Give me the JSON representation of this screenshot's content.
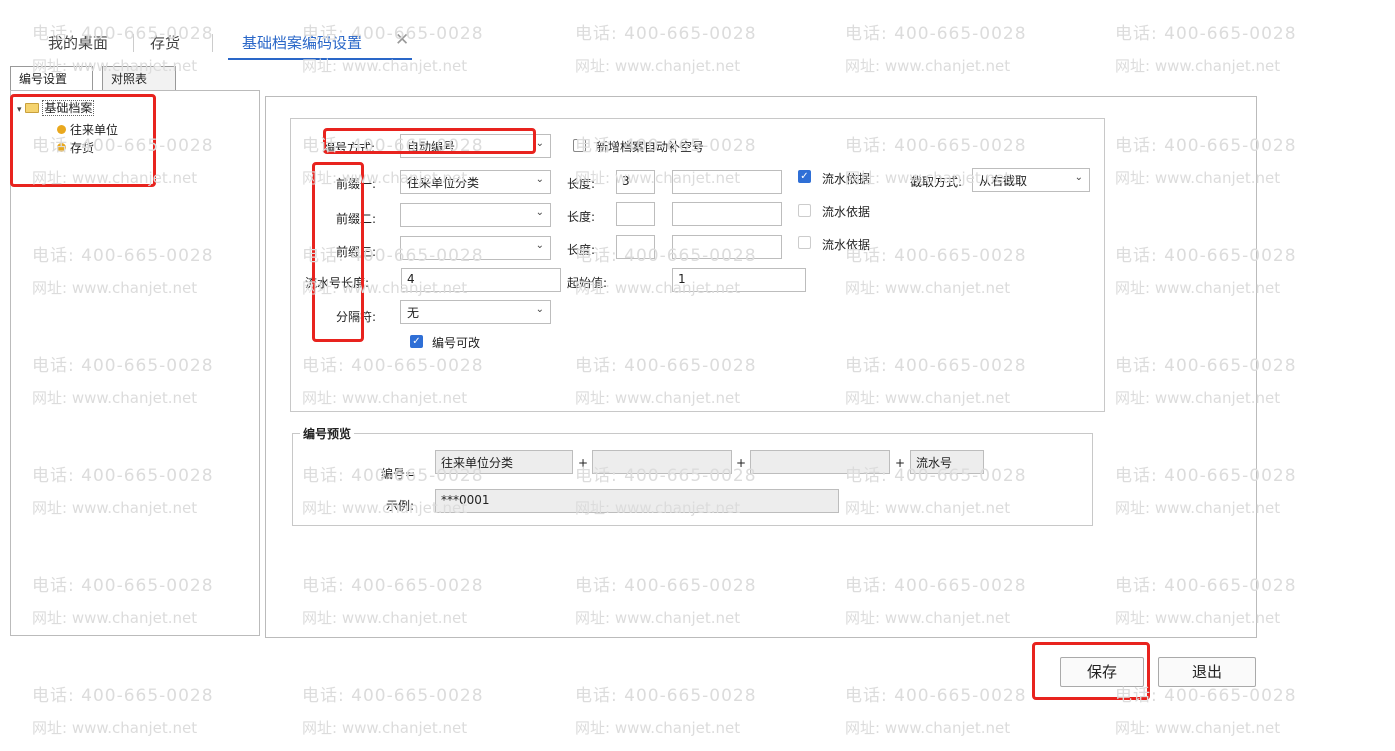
{
  "tabs": [
    "我的桌面",
    "存货",
    "基础档案编码设置"
  ],
  "subtabs": [
    "编号设置",
    "对照表"
  ],
  "tree": {
    "root": "基础档案",
    "children": [
      "往来单位",
      "存货"
    ]
  },
  "form": {
    "mode_label": "编号方式:",
    "mode_value": "自动编号",
    "autofill_label": "新增档案自动补空号",
    "prefix1_label": "前缀一:",
    "prefix1_value": "往来单位分类",
    "prefix2_label": "前缀二:",
    "prefix2_value": "",
    "prefix3_label": "前缀三:",
    "prefix3_value": "",
    "length_label": "长度:",
    "length1_value": "3",
    "flow_label": "流水依据",
    "cut_label": "截取方式:",
    "cut_value": "从右截取",
    "serial_len_label": "流水号长度:",
    "serial_len_value": "4",
    "start_label": "起始值:",
    "start_value": "1",
    "sep_label": "分隔符:",
    "sep_value": "无",
    "editable_label": "编号可改"
  },
  "preview": {
    "title": "编号预览",
    "code_label": "编号=",
    "part1": "往来单位分类",
    "plus": "+",
    "serial": "流水号",
    "example_label": "示例:",
    "example_value": "***0001"
  },
  "buttons": {
    "save": "保存",
    "exit": "退出"
  },
  "watermark": {
    "phone": "电话: 400-665-0028",
    "site": "网址: www.chanjet.net"
  },
  "colors": {
    "accent": "#2a67c8",
    "highlight": "#e8231e"
  }
}
